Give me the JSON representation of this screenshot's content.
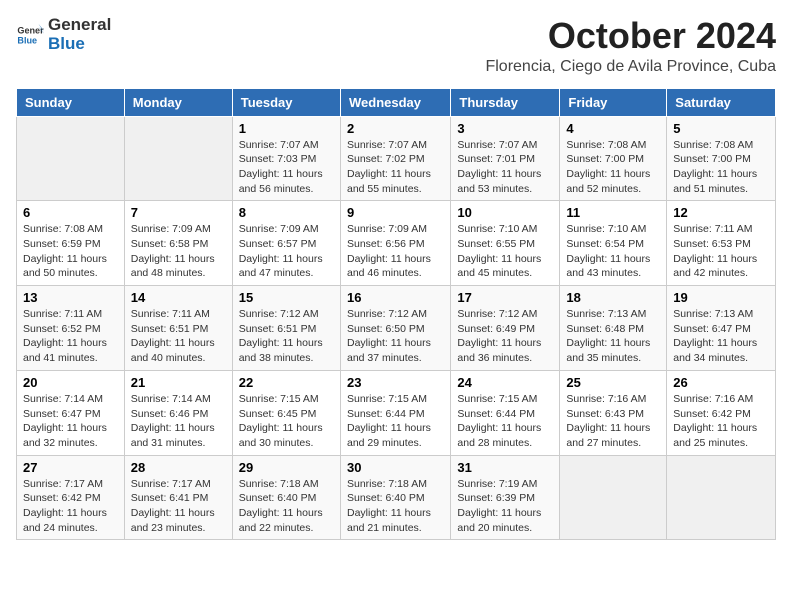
{
  "logo": {
    "text_general": "General",
    "text_blue": "Blue"
  },
  "header": {
    "month": "October 2024",
    "location": "Florencia, Ciego de Avila Province, Cuba"
  },
  "weekdays": [
    "Sunday",
    "Monday",
    "Tuesday",
    "Wednesday",
    "Thursday",
    "Friday",
    "Saturday"
  ],
  "weeks": [
    [
      {
        "day": "",
        "sunrise": "",
        "sunset": "",
        "daylight": ""
      },
      {
        "day": "",
        "sunrise": "",
        "sunset": "",
        "daylight": ""
      },
      {
        "day": "1",
        "sunrise": "Sunrise: 7:07 AM",
        "sunset": "Sunset: 7:03 PM",
        "daylight": "Daylight: 11 hours and 56 minutes."
      },
      {
        "day": "2",
        "sunrise": "Sunrise: 7:07 AM",
        "sunset": "Sunset: 7:02 PM",
        "daylight": "Daylight: 11 hours and 55 minutes."
      },
      {
        "day": "3",
        "sunrise": "Sunrise: 7:07 AM",
        "sunset": "Sunset: 7:01 PM",
        "daylight": "Daylight: 11 hours and 53 minutes."
      },
      {
        "day": "4",
        "sunrise": "Sunrise: 7:08 AM",
        "sunset": "Sunset: 7:00 PM",
        "daylight": "Daylight: 11 hours and 52 minutes."
      },
      {
        "day": "5",
        "sunrise": "Sunrise: 7:08 AM",
        "sunset": "Sunset: 7:00 PM",
        "daylight": "Daylight: 11 hours and 51 minutes."
      }
    ],
    [
      {
        "day": "6",
        "sunrise": "Sunrise: 7:08 AM",
        "sunset": "Sunset: 6:59 PM",
        "daylight": "Daylight: 11 hours and 50 minutes."
      },
      {
        "day": "7",
        "sunrise": "Sunrise: 7:09 AM",
        "sunset": "Sunset: 6:58 PM",
        "daylight": "Daylight: 11 hours and 48 minutes."
      },
      {
        "day": "8",
        "sunrise": "Sunrise: 7:09 AM",
        "sunset": "Sunset: 6:57 PM",
        "daylight": "Daylight: 11 hours and 47 minutes."
      },
      {
        "day": "9",
        "sunrise": "Sunrise: 7:09 AM",
        "sunset": "Sunset: 6:56 PM",
        "daylight": "Daylight: 11 hours and 46 minutes."
      },
      {
        "day": "10",
        "sunrise": "Sunrise: 7:10 AM",
        "sunset": "Sunset: 6:55 PM",
        "daylight": "Daylight: 11 hours and 45 minutes."
      },
      {
        "day": "11",
        "sunrise": "Sunrise: 7:10 AM",
        "sunset": "Sunset: 6:54 PM",
        "daylight": "Daylight: 11 hours and 43 minutes."
      },
      {
        "day": "12",
        "sunrise": "Sunrise: 7:11 AM",
        "sunset": "Sunset: 6:53 PM",
        "daylight": "Daylight: 11 hours and 42 minutes."
      }
    ],
    [
      {
        "day": "13",
        "sunrise": "Sunrise: 7:11 AM",
        "sunset": "Sunset: 6:52 PM",
        "daylight": "Daylight: 11 hours and 41 minutes."
      },
      {
        "day": "14",
        "sunrise": "Sunrise: 7:11 AM",
        "sunset": "Sunset: 6:51 PM",
        "daylight": "Daylight: 11 hours and 40 minutes."
      },
      {
        "day": "15",
        "sunrise": "Sunrise: 7:12 AM",
        "sunset": "Sunset: 6:51 PM",
        "daylight": "Daylight: 11 hours and 38 minutes."
      },
      {
        "day": "16",
        "sunrise": "Sunrise: 7:12 AM",
        "sunset": "Sunset: 6:50 PM",
        "daylight": "Daylight: 11 hours and 37 minutes."
      },
      {
        "day": "17",
        "sunrise": "Sunrise: 7:12 AM",
        "sunset": "Sunset: 6:49 PM",
        "daylight": "Daylight: 11 hours and 36 minutes."
      },
      {
        "day": "18",
        "sunrise": "Sunrise: 7:13 AM",
        "sunset": "Sunset: 6:48 PM",
        "daylight": "Daylight: 11 hours and 35 minutes."
      },
      {
        "day": "19",
        "sunrise": "Sunrise: 7:13 AM",
        "sunset": "Sunset: 6:47 PM",
        "daylight": "Daylight: 11 hours and 34 minutes."
      }
    ],
    [
      {
        "day": "20",
        "sunrise": "Sunrise: 7:14 AM",
        "sunset": "Sunset: 6:47 PM",
        "daylight": "Daylight: 11 hours and 32 minutes."
      },
      {
        "day": "21",
        "sunrise": "Sunrise: 7:14 AM",
        "sunset": "Sunset: 6:46 PM",
        "daylight": "Daylight: 11 hours and 31 minutes."
      },
      {
        "day": "22",
        "sunrise": "Sunrise: 7:15 AM",
        "sunset": "Sunset: 6:45 PM",
        "daylight": "Daylight: 11 hours and 30 minutes."
      },
      {
        "day": "23",
        "sunrise": "Sunrise: 7:15 AM",
        "sunset": "Sunset: 6:44 PM",
        "daylight": "Daylight: 11 hours and 29 minutes."
      },
      {
        "day": "24",
        "sunrise": "Sunrise: 7:15 AM",
        "sunset": "Sunset: 6:44 PM",
        "daylight": "Daylight: 11 hours and 28 minutes."
      },
      {
        "day": "25",
        "sunrise": "Sunrise: 7:16 AM",
        "sunset": "Sunset: 6:43 PM",
        "daylight": "Daylight: 11 hours and 27 minutes."
      },
      {
        "day": "26",
        "sunrise": "Sunrise: 7:16 AM",
        "sunset": "Sunset: 6:42 PM",
        "daylight": "Daylight: 11 hours and 25 minutes."
      }
    ],
    [
      {
        "day": "27",
        "sunrise": "Sunrise: 7:17 AM",
        "sunset": "Sunset: 6:42 PM",
        "daylight": "Daylight: 11 hours and 24 minutes."
      },
      {
        "day": "28",
        "sunrise": "Sunrise: 7:17 AM",
        "sunset": "Sunset: 6:41 PM",
        "daylight": "Daylight: 11 hours and 23 minutes."
      },
      {
        "day": "29",
        "sunrise": "Sunrise: 7:18 AM",
        "sunset": "Sunset: 6:40 PM",
        "daylight": "Daylight: 11 hours and 22 minutes."
      },
      {
        "day": "30",
        "sunrise": "Sunrise: 7:18 AM",
        "sunset": "Sunset: 6:40 PM",
        "daylight": "Daylight: 11 hours and 21 minutes."
      },
      {
        "day": "31",
        "sunrise": "Sunrise: 7:19 AM",
        "sunset": "Sunset: 6:39 PM",
        "daylight": "Daylight: 11 hours and 20 minutes."
      },
      {
        "day": "",
        "sunrise": "",
        "sunset": "",
        "daylight": ""
      },
      {
        "day": "",
        "sunrise": "",
        "sunset": "",
        "daylight": ""
      }
    ]
  ]
}
